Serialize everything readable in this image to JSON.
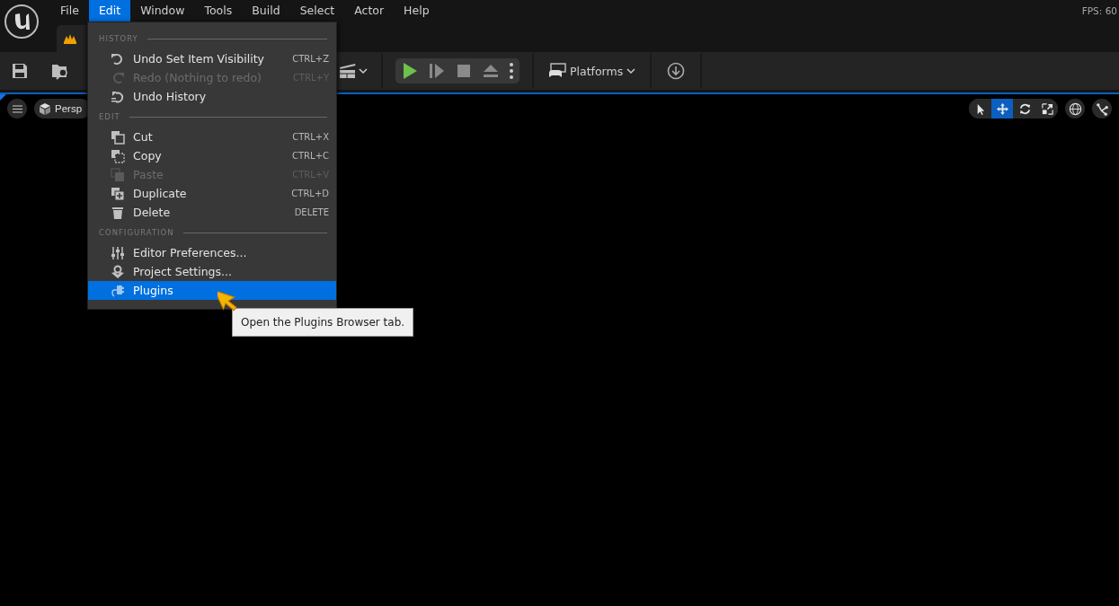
{
  "menu_bar": [
    {
      "label": "File",
      "selected": false
    },
    {
      "label": "Edit",
      "selected": true
    },
    {
      "label": "Window",
      "selected": false
    },
    {
      "label": "Tools",
      "selected": false
    },
    {
      "label": "Build",
      "selected": false
    },
    {
      "label": "Select",
      "selected": false
    },
    {
      "label": "Actor",
      "selected": false
    },
    {
      "label": "Help",
      "selected": false
    }
  ],
  "fps": "FPS: 60",
  "toolbar": {
    "platforms": "Platforms"
  },
  "viewport": {
    "view_mode": "Persp",
    "transform_tools": [
      {
        "selected": false
      },
      {
        "selected": true
      },
      {
        "selected": false
      },
      {
        "selected": false
      }
    ]
  },
  "edit_menu": [
    {
      "kind": "header",
      "label": "HISTORY"
    },
    {
      "kind": "item",
      "label": "Undo Set Item Visibility",
      "shortcut": "CTRL+Z",
      "disabled": false,
      "selected": false
    },
    {
      "kind": "item",
      "label": "Redo (Nothing to redo)",
      "shortcut": "CTRL+Y",
      "disabled": true,
      "selected": false
    },
    {
      "kind": "item",
      "label": "Undo History",
      "disabled": false,
      "selected": false
    },
    {
      "kind": "header",
      "label": "EDIT"
    },
    {
      "kind": "item",
      "label": "Cut",
      "shortcut": "CTRL+X",
      "disabled": false,
      "selected": false
    },
    {
      "kind": "item",
      "label": "Copy",
      "shortcut": "CTRL+C",
      "disabled": false,
      "selected": false
    },
    {
      "kind": "item",
      "label": "Paste",
      "shortcut": "CTRL+V",
      "disabled": true,
      "selected": false
    },
    {
      "kind": "item",
      "label": "Duplicate",
      "shortcut": "CTRL+D",
      "disabled": false,
      "selected": false
    },
    {
      "kind": "item",
      "label": "Delete",
      "shortcut": "DELETE",
      "disabled": false,
      "selected": false
    },
    {
      "kind": "header",
      "label": "CONFIGURATION"
    },
    {
      "kind": "item",
      "label": "Editor Preferences...",
      "disabled": false,
      "selected": false
    },
    {
      "kind": "item",
      "label": "Project Settings...",
      "disabled": false,
      "selected": false
    },
    {
      "kind": "item",
      "label": "Plugins",
      "disabled": false,
      "selected": true
    }
  ],
  "tooltip": "Open the Plugins Browser tab."
}
